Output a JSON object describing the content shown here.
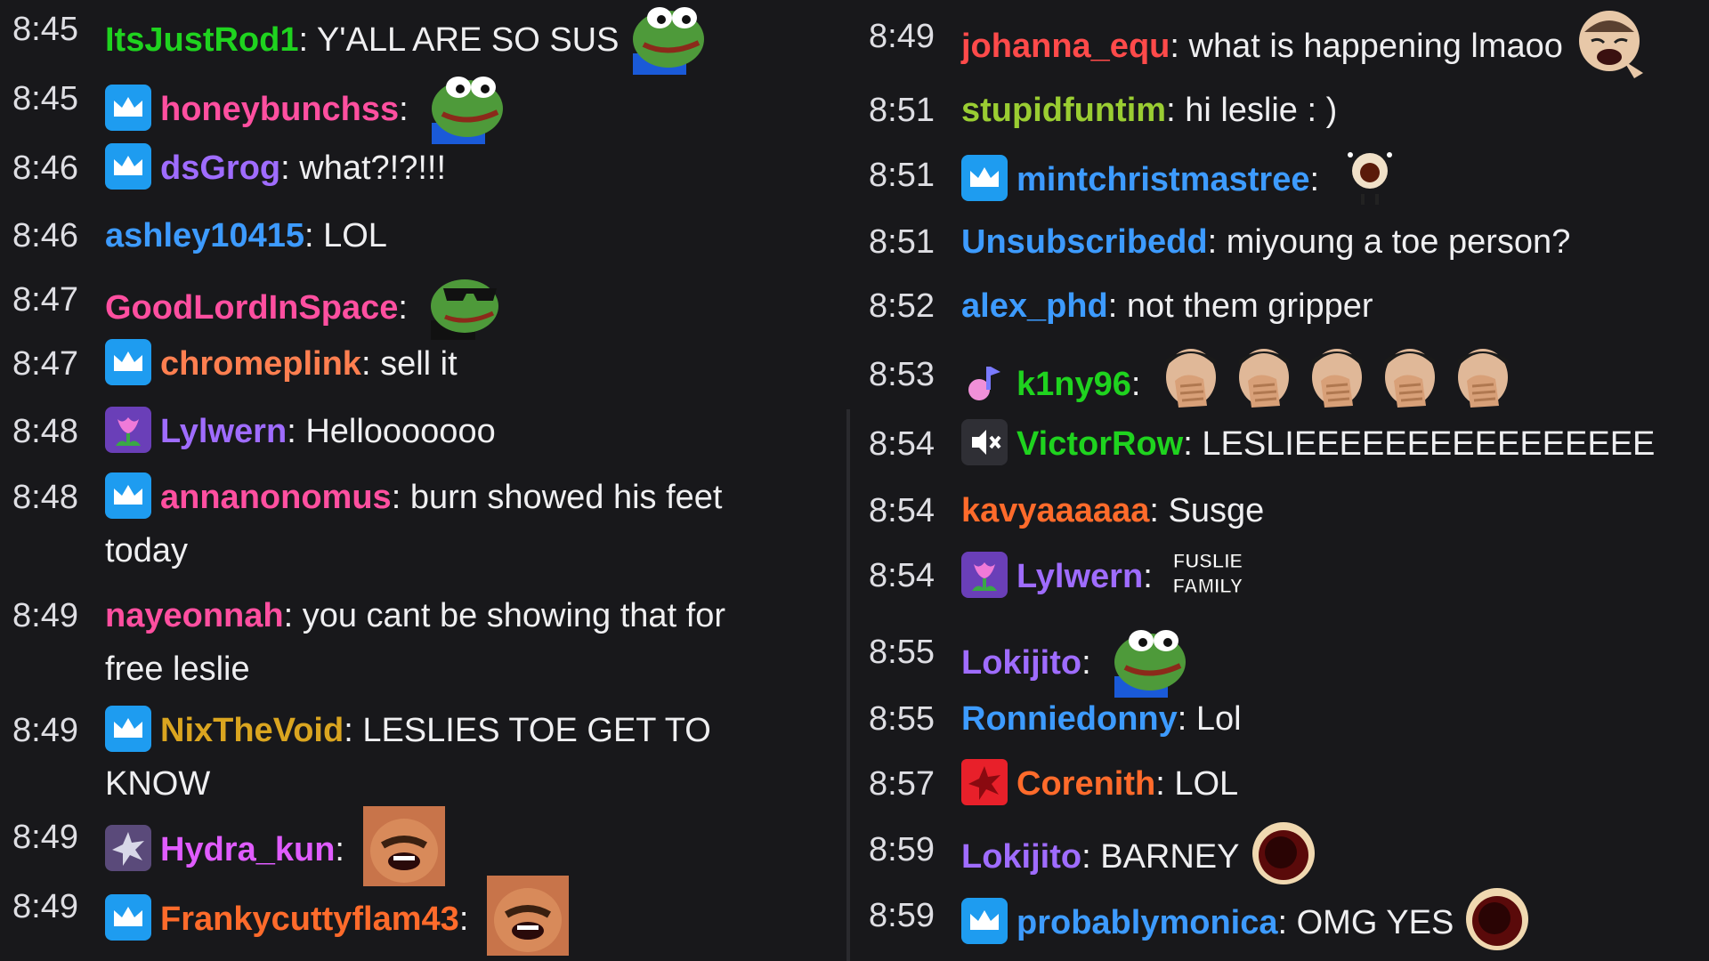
{
  "colors": {
    "background": "#18181b",
    "text": "#efeff1",
    "time": "#dedee3",
    "badge_blue": "#1e9cf0"
  },
  "left_messages": [
    {
      "time": "8:45",
      "user": "ItsJustRod1",
      "color": "#1fd31f",
      "badge": "",
      "text": "Y'ALL ARE SO SUS",
      "emote": "pepe-frog-icon"
    },
    {
      "time": "8:45",
      "user": "honeybunchss",
      "color": "#ff4fa0",
      "badge": "crown-badge-icon",
      "text": "",
      "emote": "pepe-frog-icon"
    },
    {
      "time": "8:46",
      "user": "dsGrog",
      "color": "#9f6cff",
      "badge": "crown-badge-icon",
      "text": "what?!?!!!",
      "emote": ""
    },
    {
      "time": "8:46",
      "user": "ashley10415",
      "color": "#3d9bff",
      "badge": "",
      "text": "LOL",
      "emote": ""
    },
    {
      "time": "8:47",
      "user": "GoodLordInSpace",
      "color": "#ff4fa0",
      "badge": "",
      "text": "",
      "emote": "pepe-sunglasses-icon"
    },
    {
      "time": "8:47",
      "user": "chromeplink",
      "color": "#ff7f50",
      "badge": "crown-badge-icon",
      "text": "sell it",
      "emote": ""
    },
    {
      "time": "8:48",
      "user": "Lylwern",
      "color": "#9f6cff",
      "badge": "tulip-badge-icon",
      "text": "Hellooooooo",
      "emote": ""
    },
    {
      "time": "8:48",
      "user": "annanonomus",
      "color": "#ff4fa0",
      "badge": "crown-badge-icon",
      "text": "burn showed his feet",
      "cont": "today",
      "emote": ""
    },
    {
      "time": "8:49",
      "user": "nayeonnah",
      "color": "#ff4fa0",
      "badge": "",
      "text": "you cant be showing that for",
      "cont": "free leslie",
      "emote": ""
    },
    {
      "time": "8:49",
      "user": "NixTheVoid",
      "color": "#daa520",
      "badge": "crown-badge-icon",
      "text": "LESLIES TOE GET TO",
      "cont": "KNOW",
      "emote": ""
    },
    {
      "time": "8:49",
      "user": "Hydra_kun",
      "color": "#e05cff",
      "badge": "star-badge-icon",
      "text": "",
      "emote": "laughing-face-icon"
    },
    {
      "time": "8:49",
      "user": "Frankycuttyflam43",
      "color": "#ff6b2b",
      "badge": "crown-badge-icon",
      "text": "",
      "emote": "laughing-face-icon"
    }
  ],
  "right_messages": [
    {
      "time": "8:49",
      "user": "johanna_equ",
      "color": "#ff4a4a",
      "badge": "",
      "text": "what is happening lmaoo",
      "emote": "laughing-man-icon"
    },
    {
      "time": "8:51",
      "user": "stupidfuntim",
      "color": "#9acd32",
      "badge": "",
      "text": "hi leslie : )",
      "emote": ""
    },
    {
      "time": "8:51",
      "user": "mintchristmastree",
      "color": "#3d9bff",
      "badge": "crown-badge-icon",
      "text": "",
      "emote": "singing-icon"
    },
    {
      "time": "8:51",
      "user": "Unsubscribedd",
      "color": "#3d9bff",
      "badge": "",
      "text": "miyoung a toe person?",
      "emote": ""
    },
    {
      "time": "8:52",
      "user": "alex_phd",
      "color": "#3d9bff",
      "badge": "",
      "text": "not them gripper",
      "emote": ""
    },
    {
      "time": "8:53",
      "user": "k1ny96",
      "color": "#1fd31f",
      "badge": "music-note-badge-icon",
      "text": "",
      "emote": "facepalm-icon x5"
    },
    {
      "time": "8:54",
      "user": "VictorRow",
      "color": "#1fd31f",
      "badge": "mute-badge-icon",
      "text": "LESLIEEEEEEEEEEEEEEEE",
      "emote": ""
    },
    {
      "time": "8:54",
      "user": "kavyaaaaaa",
      "color": "#ff6b2b",
      "badge": "",
      "text": "Susge",
      "emote": ""
    },
    {
      "time": "8:54",
      "user": "Lylwern",
      "color": "#9f6cff",
      "badge": "tulip-badge-icon",
      "text": "",
      "emote": "fuslie-family-icon"
    },
    {
      "time": "8:55",
      "user": "Lokijito",
      "color": "#9f6cff",
      "badge": "",
      "text": "",
      "emote": "pepe-frog-icon"
    },
    {
      "time": "8:55",
      "user": "Ronniedonny",
      "color": "#3d9bff",
      "badge": "",
      "text": "Lol",
      "emote": ""
    },
    {
      "time": "8:57",
      "user": "Corenith",
      "color": "#ff6b2b",
      "badge": "red-star-badge-icon",
      "text": "LOL",
      "emote": ""
    },
    {
      "time": "8:59",
      "user": "Lokijito",
      "color": "#9f6cff",
      "badge": "",
      "text": "BARNEY",
      "emote": "barney-icon"
    },
    {
      "time": "8:59",
      "user": "probablymonica",
      "color": "#3d9bff",
      "badge": "crown-badge-icon",
      "text": "OMG YES",
      "emote": "barney-icon"
    }
  ],
  "emote_labels": {
    "fuslie_family_line1": "FUSLIE",
    "fuslie_family_line2": "FAMILY"
  }
}
